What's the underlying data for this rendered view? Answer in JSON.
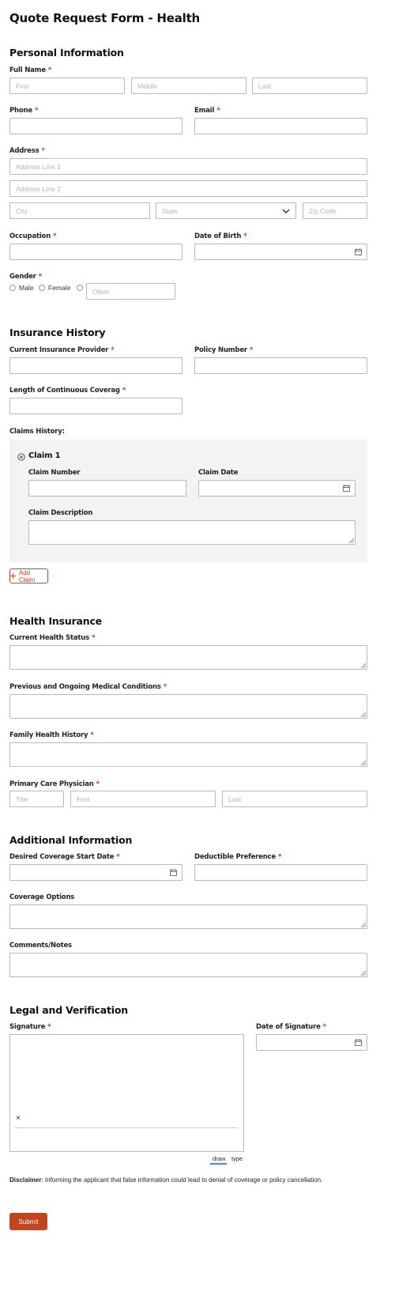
{
  "form_title": "Quote Request Form - Health",
  "required_marker": "*",
  "sections": {
    "personal": "Personal Information",
    "insurance": "Insurance History",
    "health": "Health Insurance",
    "additional": "Additional Information",
    "legal": "Legal and Verification"
  },
  "personal": {
    "full_name_label": "Full Name",
    "first_placeholder": "First",
    "middle_placeholder": "Middle",
    "last_placeholder": "Last",
    "phone_label": "Phone",
    "email_label": "Email",
    "address_label": "Address",
    "address1_placeholder": "Address Line 1",
    "address2_placeholder": "Address Line 2",
    "city_placeholder": "City",
    "state_placeholder": "State",
    "zip_placeholder": "Zip Code",
    "occupation_label": "Occupation",
    "dob_label": "Date of Birth",
    "gender_label": "Gender",
    "gender_male": "Male",
    "gender_female": "Female",
    "gender_other_placeholder": "Other"
  },
  "insurance": {
    "provider_label": "Current Insurance Provider",
    "policy_label": "Policy Number",
    "coverage_length_label": "Length of Continuous Coverag",
    "claims_history_label": "Claims History:",
    "claim_title": "Claim 1",
    "claim_number_label": "Claim Number",
    "claim_date_label": "Claim Date",
    "claim_description_label": "Claim Description",
    "add_claim_label": "Add Claim"
  },
  "health": {
    "status_label": "Current Health Status",
    "conditions_label": "Previous and Ongoing Medical Conditions",
    "family_label": "Family Health History",
    "physician_label": "Primary Care Physician",
    "title_placeholder": "Title",
    "first_placeholder": "First",
    "last_placeholder": "Last"
  },
  "additional": {
    "start_date_label": "Desired Coverage Start Date",
    "deductible_label": "Deductible Preference",
    "coverage_options_label": "Coverage Options",
    "comments_label": "Comments/Notes"
  },
  "legal": {
    "signature_label": "Signature",
    "date_signature_label": "Date of Signature",
    "clear_mark": "×",
    "tab_draw": "draw",
    "tab_type": "type",
    "disclaimer_bold": "Disclaimer",
    "disclaimer_text": ": Informing the applicant that false information could lead to denial of coverage or policy cancellation."
  },
  "submit_label": "Submit",
  "colors": {
    "accent": "#c1461f",
    "required": "#c0392b",
    "border": "#b9b9b9",
    "placeholder": "#b3b3b3",
    "claim_background": "#f3f3f3"
  },
  "icons": {
    "calendar": "calendar-icon",
    "chevron": "chevron-down-icon",
    "remove": "remove-circle-icon",
    "plus": "plus-icon"
  }
}
